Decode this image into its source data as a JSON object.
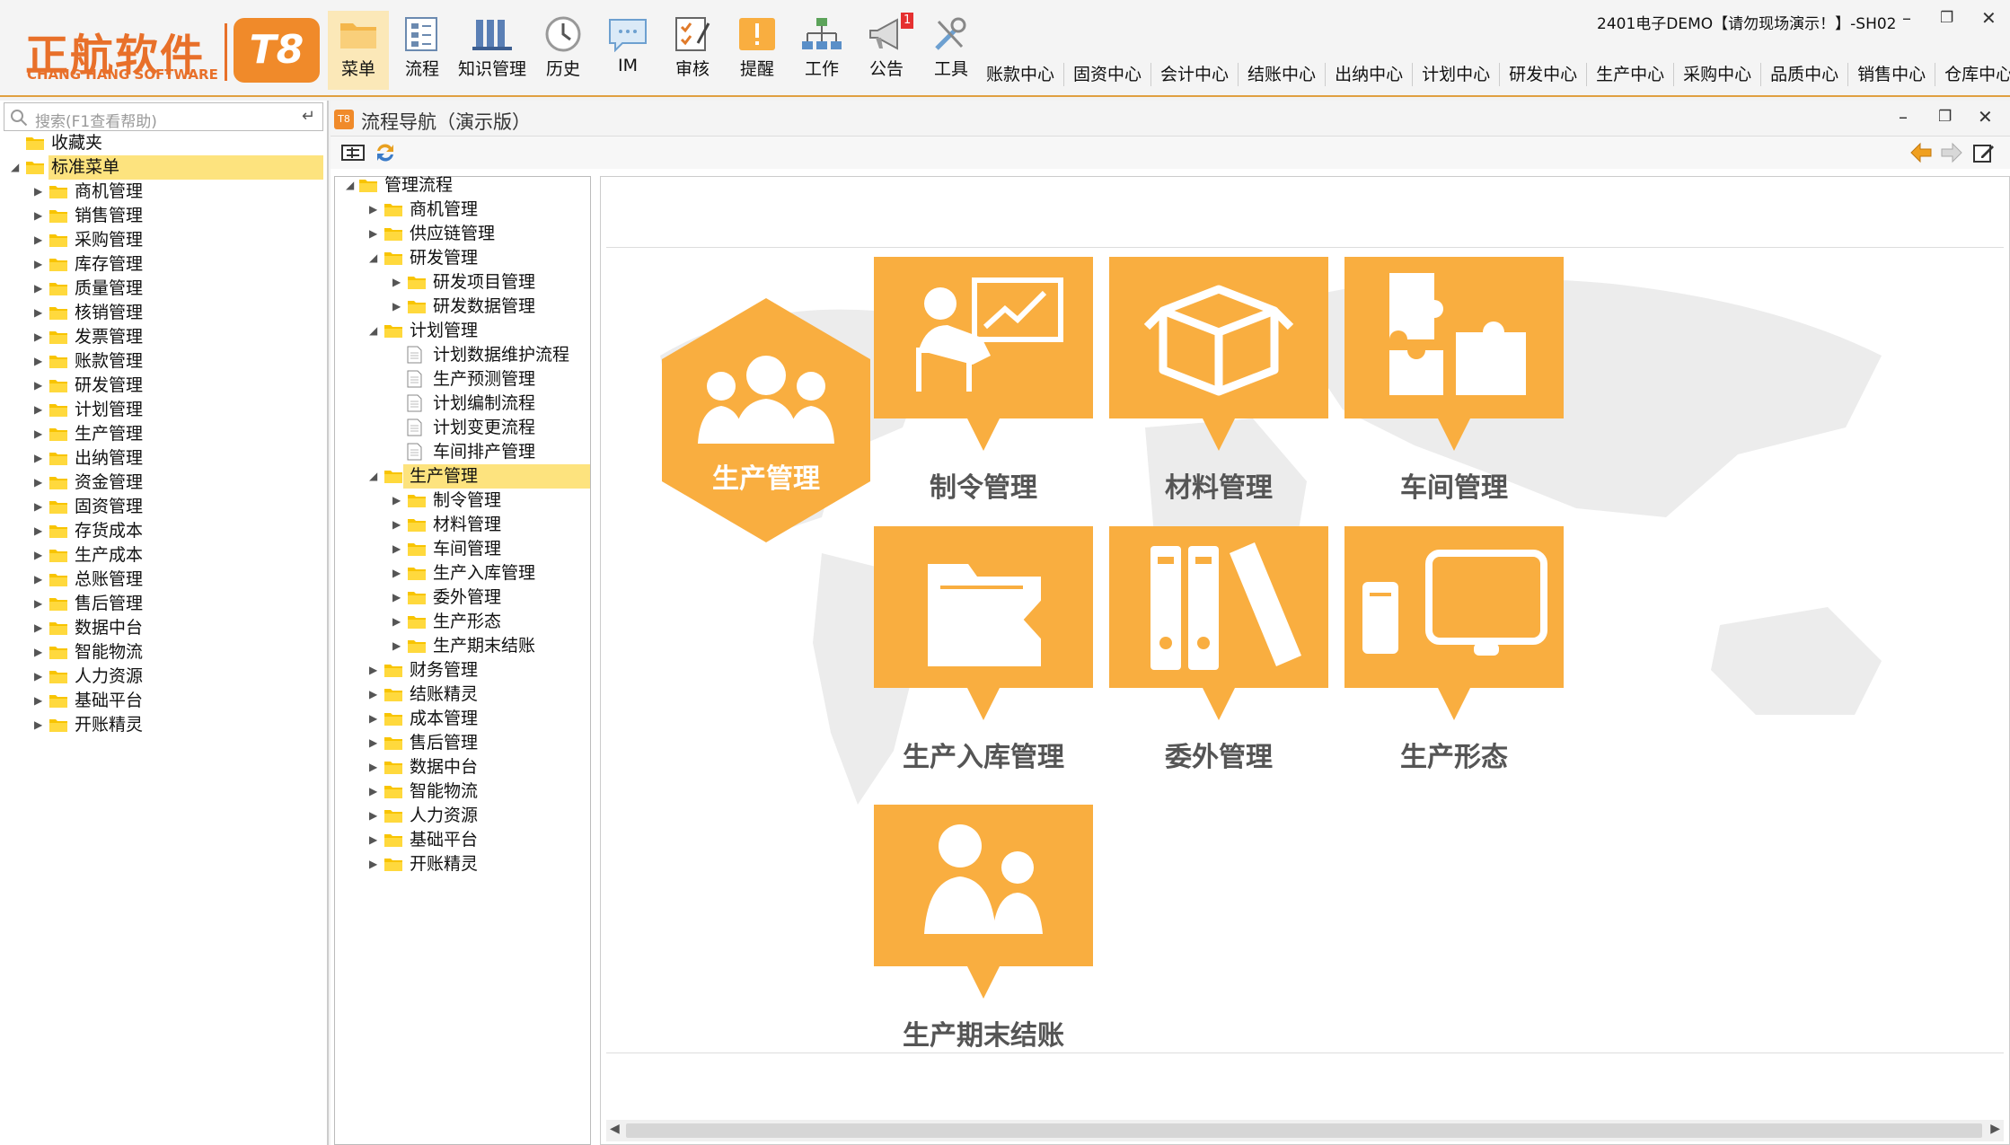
{
  "logo": {
    "cn": "正航软件",
    "en": "CHANG HANG SOFTWARE",
    "badge": "T8"
  },
  "toolbar": [
    {
      "label": "菜单",
      "icon": "folder-icon"
    },
    {
      "label": "流程",
      "icon": "flowchart-icon"
    },
    {
      "label": "知识管理",
      "icon": "books-icon"
    },
    {
      "label": "历史",
      "icon": "clock-icon"
    },
    {
      "label": "IM",
      "icon": "chat-icon"
    },
    {
      "label": "审核",
      "icon": "checklist-icon"
    },
    {
      "label": "提醒",
      "icon": "alert-icon"
    },
    {
      "label": "工作",
      "icon": "org-chart-icon"
    },
    {
      "label": "公告",
      "icon": "megaphone-icon",
      "badge": "1"
    },
    {
      "label": "工具",
      "icon": "tools-icon"
    }
  ],
  "window_title": "2401电子DEMO【请勿现场演示！】-SH02",
  "centers": [
    "账款中心",
    "固资中心",
    "会计中心",
    "结账中心",
    "出纳中心",
    "计划中心",
    "研发中心",
    "生产中心",
    "采购中心",
    "品质中心",
    "销售中心",
    "仓库中心"
  ],
  "search": {
    "placeholder": "搜索(F1查看帮助)",
    "enter": "↵"
  },
  "left_tree": {
    "favorites": "收藏夹",
    "standard_menu": "标准菜单",
    "items": [
      "商机管理",
      "销售管理",
      "采购管理",
      "库存管理",
      "质量管理",
      "核销管理",
      "发票管理",
      "账款管理",
      "研发管理",
      "计划管理",
      "生产管理",
      "出纳管理",
      "资金管理",
      "固资管理",
      "存货成本",
      "生产成本",
      "总账管理",
      "售后管理",
      "数据中台",
      "智能物流",
      "人力资源",
      "基础平台",
      "开账精灵"
    ]
  },
  "main_window": {
    "title": "流程导航（演示版）",
    "icon_label": "T8"
  },
  "nav_tree": {
    "root": "管理流程",
    "nodes": [
      {
        "label": "商机管理",
        "level": 1,
        "type": "folder",
        "state": "collapsed"
      },
      {
        "label": "供应链管理",
        "level": 1,
        "type": "folder",
        "state": "collapsed"
      },
      {
        "label": "研发管理",
        "level": 1,
        "type": "folder",
        "state": "expanded"
      },
      {
        "label": "研发项目管理",
        "level": 2,
        "type": "folder",
        "state": "collapsed"
      },
      {
        "label": "研发数据管理",
        "level": 2,
        "type": "folder",
        "state": "collapsed"
      },
      {
        "label": "计划管理",
        "level": 1,
        "type": "folder",
        "state": "expanded"
      },
      {
        "label": "计划数据维护流程",
        "level": 2,
        "type": "doc"
      },
      {
        "label": "生产预测管理",
        "level": 2,
        "type": "doc"
      },
      {
        "label": "计划编制流程",
        "level": 2,
        "type": "doc"
      },
      {
        "label": "计划变更流程",
        "level": 2,
        "type": "doc"
      },
      {
        "label": "车间排产管理",
        "level": 2,
        "type": "doc"
      },
      {
        "label": "生产管理",
        "level": 1,
        "type": "folder",
        "state": "expanded",
        "selected": true
      },
      {
        "label": "制令管理",
        "level": 2,
        "type": "folder",
        "state": "collapsed"
      },
      {
        "label": "材料管理",
        "level": 2,
        "type": "folder",
        "state": "collapsed"
      },
      {
        "label": "车间管理",
        "level": 2,
        "type": "folder",
        "state": "collapsed"
      },
      {
        "label": "生产入库管理",
        "level": 2,
        "type": "folder",
        "state": "collapsed"
      },
      {
        "label": "委外管理",
        "level": 2,
        "type": "folder",
        "state": "collapsed"
      },
      {
        "label": "生产形态",
        "level": 2,
        "type": "folder",
        "state": "collapsed"
      },
      {
        "label": "生产期末结账",
        "level": 2,
        "type": "folder",
        "state": "collapsed"
      },
      {
        "label": "财务管理",
        "level": 1,
        "type": "folder",
        "state": "collapsed"
      },
      {
        "label": "结账精灵",
        "level": 1,
        "type": "folder",
        "state": "collapsed"
      },
      {
        "label": "成本管理",
        "level": 1,
        "type": "folder",
        "state": "collapsed"
      },
      {
        "label": "售后管理",
        "level": 1,
        "type": "folder",
        "state": "collapsed"
      },
      {
        "label": "数据中台",
        "level": 1,
        "type": "folder",
        "state": "collapsed"
      },
      {
        "label": "智能物流",
        "level": 1,
        "type": "folder",
        "state": "collapsed"
      },
      {
        "label": "人力资源",
        "level": 1,
        "type": "folder",
        "state": "collapsed"
      },
      {
        "label": "基础平台",
        "level": 1,
        "type": "folder",
        "state": "collapsed"
      },
      {
        "label": "开账精灵",
        "level": 1,
        "type": "folder",
        "state": "collapsed"
      }
    ]
  },
  "flow": {
    "center": {
      "label": "生产管理",
      "icon": "people-group-icon"
    },
    "tiles": [
      {
        "label": "制令管理",
        "icon": "presentation-icon"
      },
      {
        "label": "材料管理",
        "icon": "box-icon"
      },
      {
        "label": "车间管理",
        "icon": "puzzle-icon"
      },
      {
        "label": "生产入库管理",
        "icon": "folder-open-icon"
      },
      {
        "label": "委外管理",
        "icon": "binders-icon"
      },
      {
        "label": "生产形态",
        "icon": "devices-icon"
      },
      {
        "label": "生产期末结账",
        "icon": "users-icon"
      }
    ]
  },
  "colors": {
    "accent": "#f9ae40",
    "logo": "#e8702a",
    "selection": "#fde37e",
    "folder": "#f8c400"
  }
}
